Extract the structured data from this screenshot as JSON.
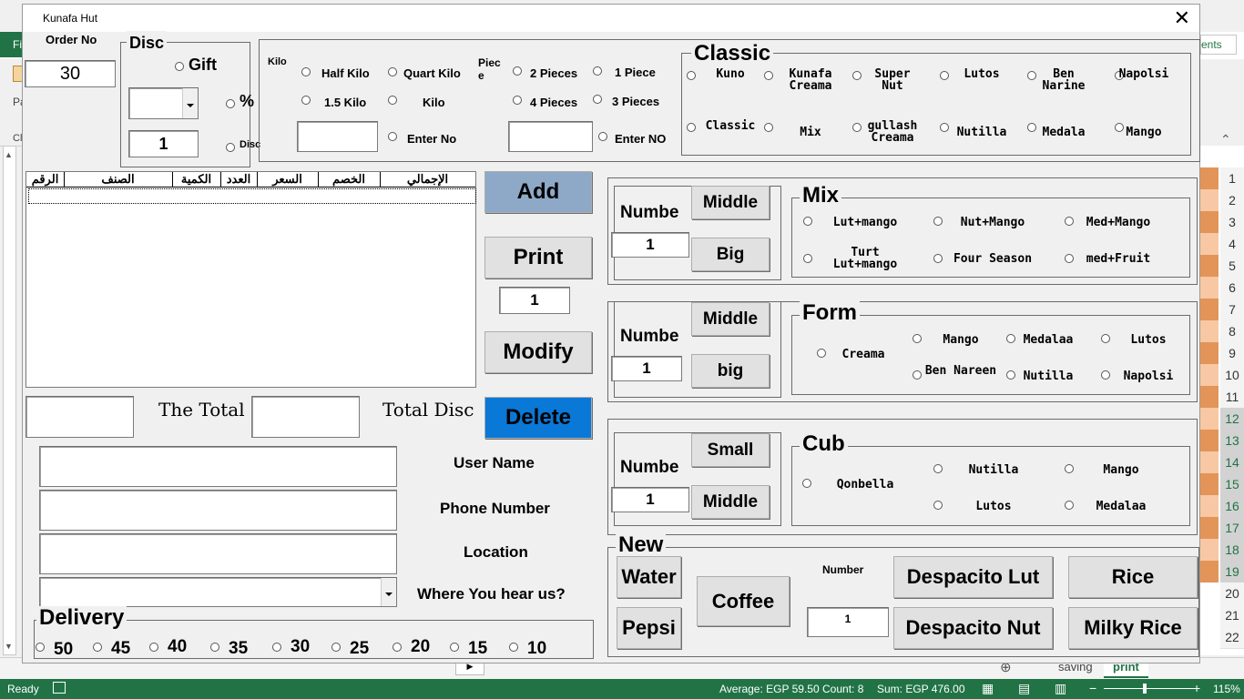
{
  "excel": {
    "file_tab": "Fi",
    "right_tab": "ents",
    "paste_label": "Pa",
    "clip_label": "Cli",
    "status_ready": "Ready",
    "status_average": "Average: EGP 59.50",
    "status_count": "Count: 8",
    "status_sum": "Sum: EGP 476.00",
    "zoom": "115%",
    "sheet_tabs": [
      "saving",
      "print"
    ],
    "row_numbers": [
      "1",
      "2",
      "3",
      "4",
      "5",
      "6",
      "7",
      "8",
      "9",
      "10",
      "11",
      "12",
      "13",
      "14",
      "15",
      "16",
      "17",
      "18",
      "19",
      "20",
      "21",
      "22"
    ]
  },
  "dialog": {
    "title": "Kunafa Hut",
    "order_no_label": "Order No",
    "order_no_value": "30",
    "disc": {
      "title": "Disc",
      "gift": "Gift",
      "percent": "%",
      "disc": "Disc",
      "disc_value": "1"
    },
    "size": {
      "kilo_label": "Kilo",
      "half_kilo": "Half Kilo",
      "quart_kilo": "Quart Kilo",
      "one_half_kilo": "1.5 Kilo",
      "kilo": "Kilo",
      "enter_no": "Enter No",
      "piece_label": "Piec e",
      "two_pieces": "2 Pieces",
      "one_piece": "1 Piece",
      "four_pieces": "4 Pieces",
      "three_pieces": "3 Pieces",
      "enter_no2": "Enter NO"
    },
    "classic": {
      "title": "Classic",
      "row1": [
        "Kuno",
        "Kunafa Creama",
        "Super Nut",
        "Lutos",
        "Ben Narine",
        "Napolsi"
      ],
      "row2": [
        "Classic",
        "Mix",
        "gullash Creama",
        "Nutilla",
        "Medala",
        "Mango"
      ]
    },
    "grid_headers": [
      "الإجمالي",
      "الخصم",
      "السعر",
      "العدد",
      "الكمية",
      "الصنف",
      "الرقم"
    ],
    "buttons": {
      "add": "Add",
      "print": "Print",
      "print_copies": "1",
      "modify": "Modify",
      "delete": "Delete"
    },
    "totals": {
      "the_total": "The Total",
      "total_disc": "Total Disc"
    },
    "customer": {
      "user_name": "User Name",
      "phone_number": "Phone Number",
      "location": "Location",
      "where_hear": "Where You hear us?"
    },
    "delivery": {
      "title": "Delivery",
      "options": [
        "50",
        "45",
        "40",
        "35",
        "30",
        "25",
        "20",
        "15",
        "10"
      ]
    },
    "mix_panel": {
      "numbe": "Numbe",
      "number_value": "1",
      "middle": "Middle",
      "big": "Big",
      "title": "Mix",
      "row1": [
        "Lut+mango",
        "Nut+Mango",
        "Med+Mango"
      ],
      "row2": [
        "Turt Lut+mango",
        "Four Season",
        "med+Fruit"
      ]
    },
    "form_panel": {
      "numbe": "Numbe",
      "number_value": "1",
      "middle": "Middle",
      "big": "big",
      "title": "Form",
      "creama": "Creama",
      "row1": [
        "Mango",
        "Medalaa",
        "Lutos"
      ],
      "row2": [
        "Ben Nareen",
        "Nutilla",
        "Napolsi"
      ]
    },
    "cub_panel": {
      "numbe": "Numbe",
      "number_value": "1",
      "small": "Small",
      "middle": "Middle",
      "title": "Cub",
      "qonbella": "Qonbella",
      "row1": [
        "Nutilla",
        "Mango"
      ],
      "row2": [
        "Lutos",
        "Medalaa"
      ]
    },
    "new_panel": {
      "title": "New",
      "water": "Water",
      "pepsi": "Pepsi",
      "coffee": "Coffee",
      "number_label": "Number",
      "number_value": "1",
      "despacito_lut": "Despacito Lut",
      "despacito_nut": "Despacito Nut",
      "rice": "Rice",
      "milky_rice": "Milky Rice"
    }
  }
}
